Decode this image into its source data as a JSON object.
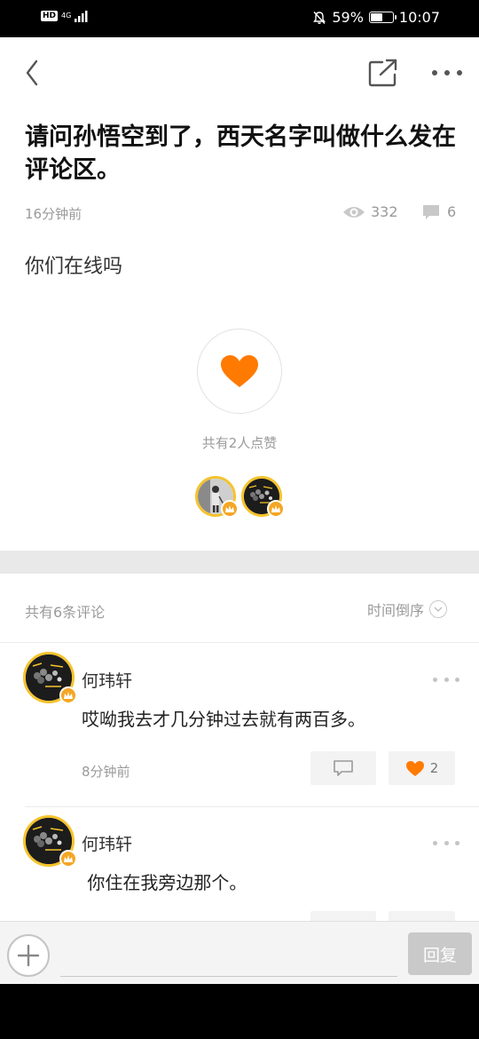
{
  "status_bar": {
    "hd": "HD",
    "network": "4G",
    "battery_percent": "59%",
    "battery_level": 0.59,
    "time": "10:07"
  },
  "post": {
    "title": "请问孙悟空到了，西天名字叫做什么发在评论区。",
    "time_ago": "16分钟前",
    "views": "332",
    "comment_count": "6",
    "body": "你们在线吗",
    "likes_text": "共有2人点赞"
  },
  "comments_section": {
    "count_label": "共有6条评论",
    "sort_label": "时间倒序",
    "items": [
      {
        "author": "何玮轩",
        "text": "哎呦我去才几分钟过去就有两百多。",
        "time": "8分钟前",
        "likes": "2"
      },
      {
        "author": "何玮轩",
        "text": " 你住在我旁边那个。"
      }
    ]
  },
  "reply_bar": {
    "placeholder": "",
    "submit_label": "回复"
  },
  "colors": {
    "accent": "#FF7A00",
    "avatar_ring": "#F5C32C",
    "crown": "#F5A623"
  }
}
